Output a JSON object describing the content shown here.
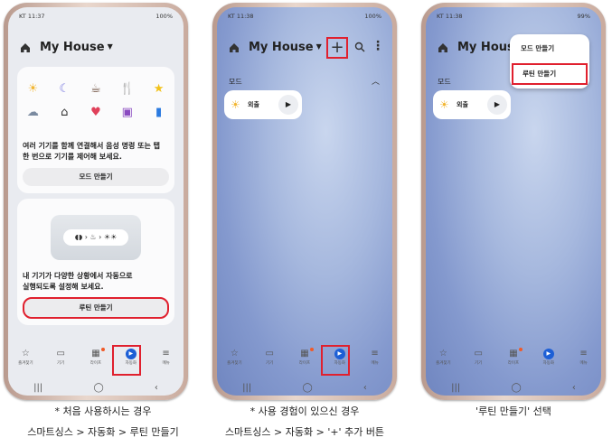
{
  "phone1": {
    "status": {
      "carrier": "KT",
      "time": "11:37",
      "right": "100%"
    },
    "home_title": "My House",
    "card1_icons": [
      "☀",
      "☾",
      "☕",
      "🍴",
      "★",
      "☁",
      "⌂",
      "♥",
      "▣",
      "▮"
    ],
    "card1_text_line1": "여러 기기를 함께 연결해서 음성 명령 또는 탭",
    "card1_text_line2": "한 번으로 기기를 제어해 보세요.",
    "card1_button": "모드 만들기",
    "card2_text_line1": "내 기기가 다양한 상황에서 자동으로",
    "card2_text_line2": "실행되도록 설정해 보세요.",
    "card2_button": "루틴 만들기"
  },
  "phone2": {
    "status": {
      "carrier": "KT",
      "time": "11:38",
      "right": "100%"
    },
    "home_title": "My House",
    "plus_label": "+",
    "section_label": "모드",
    "mode_name": "외출"
  },
  "phone3": {
    "status": {
      "carrier": "KT",
      "time": "11:38",
      "right": "99%"
    },
    "home_title": "My House",
    "section_label": "모드",
    "mode_name": "외출",
    "dropdown": [
      "모드 만들기",
      "루틴 만들기"
    ]
  },
  "nav_items": [
    "즐겨찾기",
    "기기",
    "라이프",
    "자동화",
    "메뉴"
  ],
  "sys_nav": [
    "|||",
    "◯",
    "‹"
  ],
  "captions": {
    "c1_line1": "* 처음 사용하시는 경우",
    "c1_line2": "스마트싱스 > 자동화 > 루틴 만들기",
    "c2_line1": "* 사용 경험이 있으신 경우",
    "c2_line2": "스마트싱스 > 자동화 > '+' 추가 버튼",
    "c3_line1": "'루틴 만들기' 선택"
  },
  "colors": {
    "highlight": "#e0202e",
    "active_nav": "#1d5fd6"
  }
}
